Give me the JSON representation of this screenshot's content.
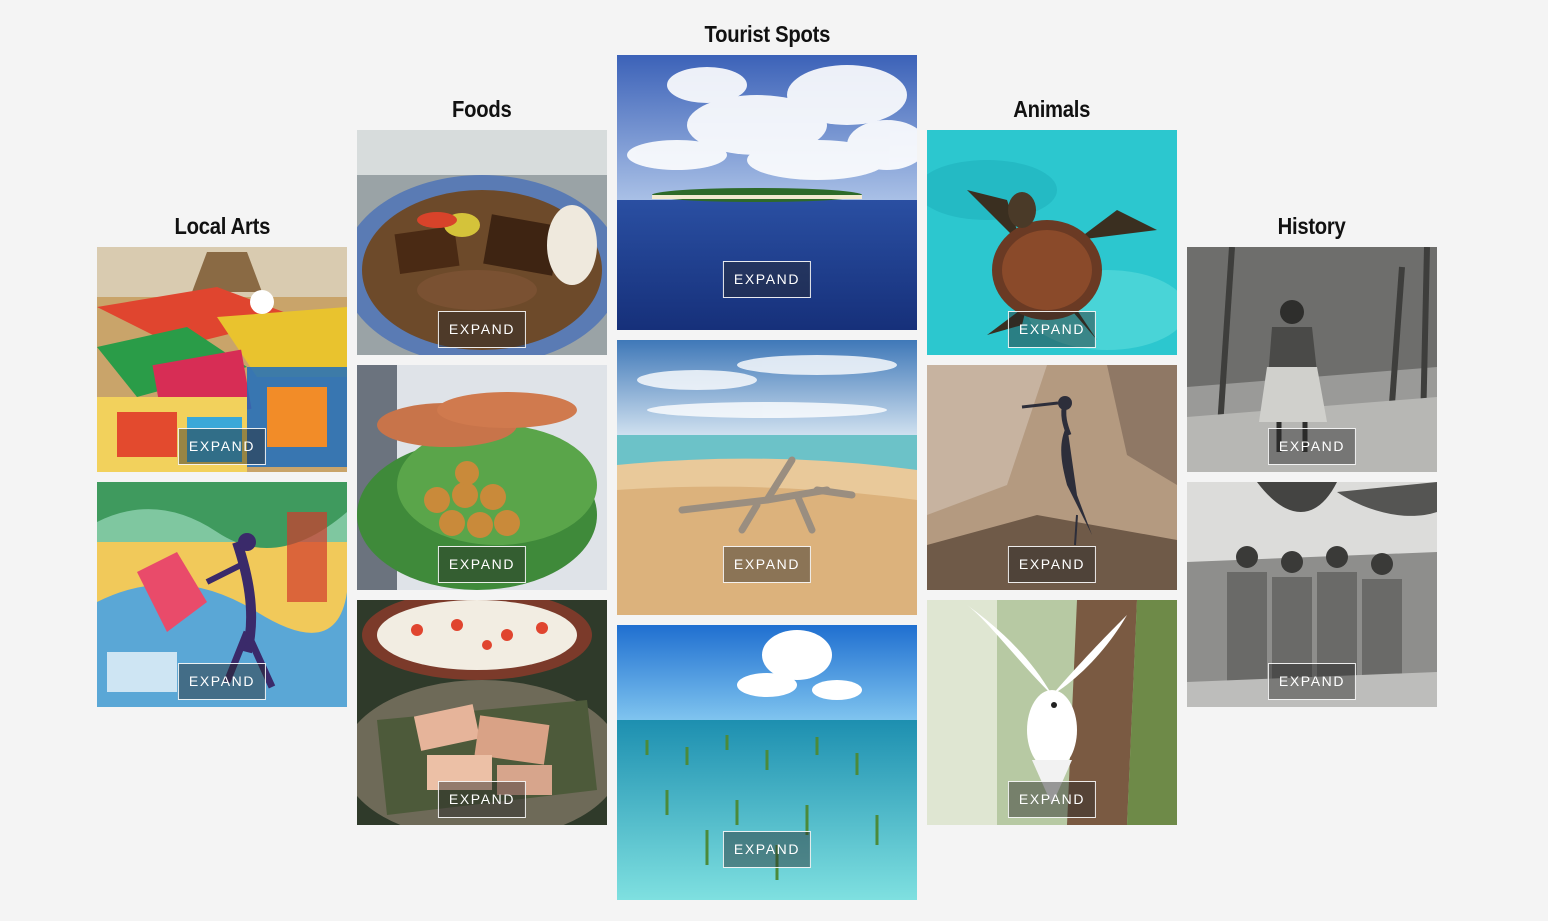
{
  "columns": [
    {
      "title": "Local Arts",
      "tiles": [
        {
          "image": "crochet-market-stall",
          "expand_label": "EXPAND"
        },
        {
          "image": "colorful-painting-dancer",
          "expand_label": "EXPAND"
        }
      ]
    },
    {
      "title": "Foods",
      "tiles": [
        {
          "image": "plate-of-stew",
          "expand_label": "EXPAND"
        },
        {
          "image": "lobster-and-fritters",
          "expand_label": "EXPAND"
        },
        {
          "image": "raw-fish-and-pork-basket",
          "expand_label": "EXPAND"
        }
      ]
    },
    {
      "title": "Tourist Spots",
      "tiles": [
        {
          "image": "island-in-ocean",
          "expand_label": "EXPAND"
        },
        {
          "image": "driftwood-beach",
          "expand_label": "EXPAND"
        },
        {
          "image": "mangrove-lagoon",
          "expand_label": "EXPAND"
        }
      ]
    },
    {
      "title": "Animals",
      "tiles": [
        {
          "image": "sea-turtle",
          "expand_label": "EXPAND"
        },
        {
          "image": "heron-on-rock",
          "expand_label": "EXPAND"
        },
        {
          "image": "white-tern",
          "expand_label": "EXPAND"
        }
      ]
    },
    {
      "title": "History",
      "tiles": [
        {
          "image": "historic-photo-woman",
          "expand_label": "EXPAND"
        },
        {
          "image": "historic-photo-group",
          "expand_label": "EXPAND"
        }
      ]
    }
  ]
}
